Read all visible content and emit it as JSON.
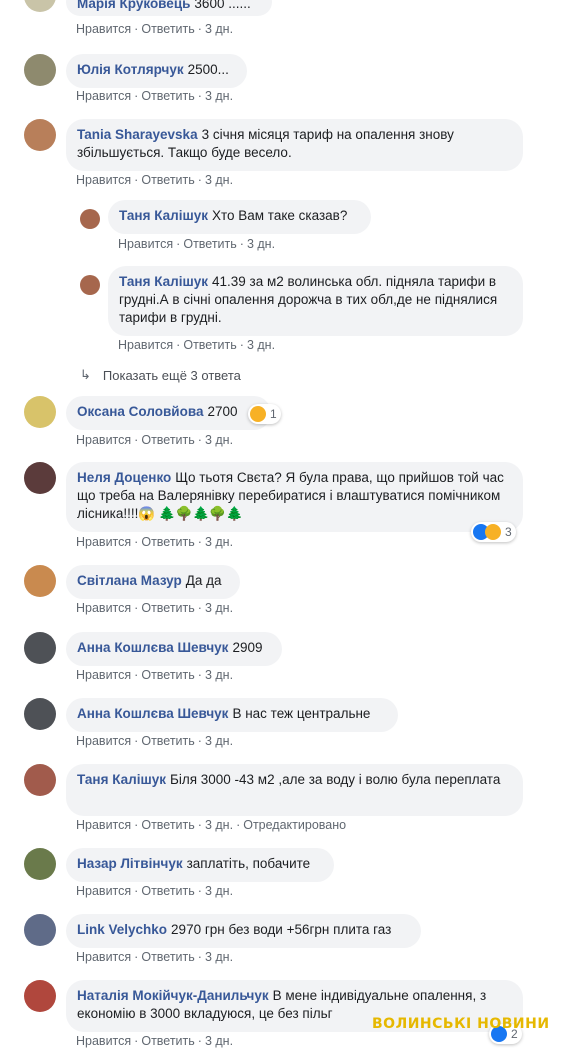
{
  "actions": {
    "like": "Нравится",
    "reply": "Ответить"
  },
  "comments": [
    {
      "author": "Марія Круковець",
      "text": "3600 ......",
      "time": "3 дн."
    },
    {
      "author": "Юлія Котлярчук",
      "text": "2500...",
      "time": "3 дн."
    },
    {
      "author": "Tania Sharayevska",
      "text": "3 січня місяця тариф на опалення знову збільшується. Такщо буде весело.",
      "time": "3 дн."
    },
    {
      "author": "Таня Калішук",
      "text": "Хто Вам таке сказав?",
      "time": "3 дн."
    },
    {
      "author": "Таня Калішук",
      "text": "41.39 за м2 волинська обл. підняла тарифи в грудні.А в січні опалення дорожча в тих обл,де не піднялися тарифи в грудні.",
      "time": "3 дн."
    },
    {
      "author": "Оксана Соловйова",
      "text": "2700",
      "time": "3 дн.",
      "reactions": "1"
    },
    {
      "author": "Неля Доценко",
      "text": "Що тьотя Свєта? Я була права, що прийшов той час що треба на Валерянівку перебиратися і влаштуватися помічником лісника!!!!😱 🌲🌳🌲🌳🌲",
      "time": "3 дн.",
      "reactions": "3"
    },
    {
      "author": "Світлана Мазур",
      "text": "Да да",
      "time": "3 дн."
    },
    {
      "author": "Анна Кошлєва Шевчук",
      "text": "2909",
      "time": "3 дн."
    },
    {
      "author": "Анна Кошлєва Шевчук",
      "text": "В нас теж центральне",
      "time": "3 дн."
    },
    {
      "author": "Таня Калішук",
      "text": "Біля 3000 -43 м2 ,але за воду і волю була переплата",
      "time": "3 дн.",
      "edited": "Отредактировано"
    },
    {
      "author": "Назар Літвінчук",
      "text": "заплатіть, побачите",
      "time": "3 дн."
    },
    {
      "author": "Link Velychko",
      "text": "2970 грн без води +56грн плита газ",
      "time": "3 дн."
    },
    {
      "author": "Наталія Мокійчук-Данильчук",
      "text": "В мене індивідуальне опалення, з економію в 3000 вкладуюся, це без пільг",
      "time": "3 дн.",
      "reactions": "2"
    }
  ],
  "show_more": "Показать ещё 3 ответа",
  "watermark": "ВОЛИНСЬКІ НОВИНИ",
  "colors": {
    "author": "#385898",
    "bubble": "#f2f3f5",
    "meta": "#606770"
  }
}
